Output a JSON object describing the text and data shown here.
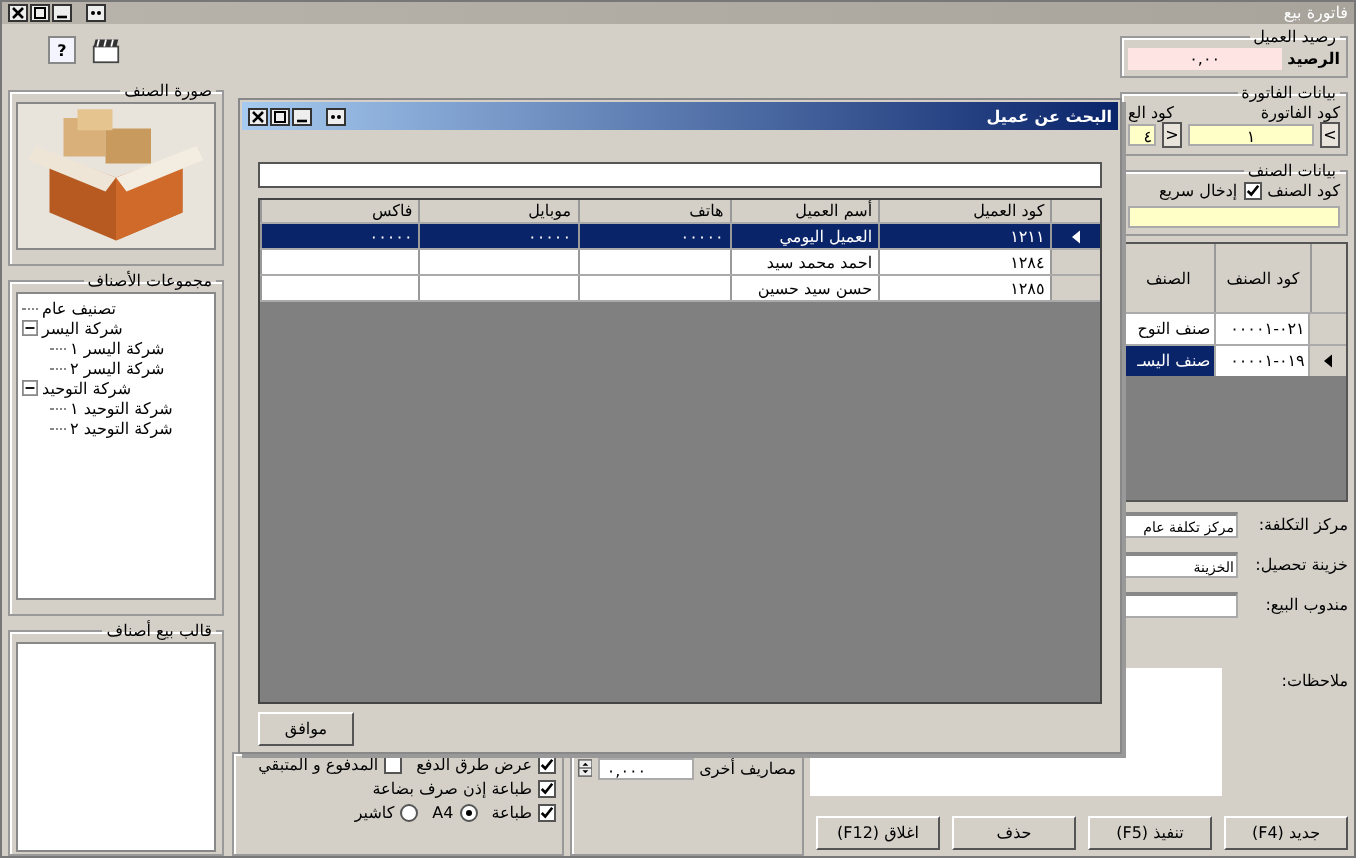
{
  "window": {
    "title": "فاتورة بيع",
    "help_glyph": "?"
  },
  "item_image": {
    "title": "صورة الصنف"
  },
  "item_groups": {
    "title": "مجموعات الأصناف",
    "tree": [
      {
        "label": "تصنيف عام"
      },
      {
        "label": "شركة اليسر",
        "expanded": true,
        "children": [
          {
            "label": "شركة اليسر ١"
          },
          {
            "label": "شركة اليسر ٢"
          }
        ]
      },
      {
        "label": "شركة التوحيد",
        "expanded": true,
        "children": [
          {
            "label": "شركة التوحيد ١"
          },
          {
            "label": "شركة التوحيد ٢"
          }
        ]
      }
    ]
  },
  "sale_template": {
    "title": "قالب بيع أصناف"
  },
  "customer_balance": {
    "title": "رصيد العميل",
    "label": "الرصيد",
    "value": "٠,٠٠"
  },
  "invoice_data": {
    "title": "بيانات الفاتورة",
    "code_label": "كود الفاتورة",
    "code_value": "١",
    "prev": "<",
    "next": ">",
    "customer_code_label": "كود الع",
    "customer_code_value": "٤"
  },
  "item_data": {
    "title": "بيانات الصنف",
    "code_label": "كود الصنف",
    "quick_entry": {
      "label": "إدخال سريع",
      "checked": true
    }
  },
  "items_grid": {
    "columns": [
      "كود الصنف",
      "الصنف"
    ],
    "rows": [
      {
        "code": "٠٢١-٠٠٠٠١",
        "name": "صنف التوح",
        "selected": false
      },
      {
        "code": "٠١٩-٠٠٠٠١",
        "name": "صنف اليسـ",
        "selected": true
      }
    ]
  },
  "fields": [
    {
      "label": "مركز التكلفة:",
      "value": "مركز تكلفة عام"
    },
    {
      "label": "خزينة تحصيل:",
      "value": "الخزينة"
    },
    {
      "label": "مندوب البيع:"
    }
  ],
  "notes": {
    "label": "ملاحظات:"
  },
  "other_expenses": {
    "label": "مصاريف أخرى",
    "value": "٠,٠٠٠"
  },
  "print_options": [
    [
      {
        "kind": "checkbox",
        "label": "عرض طرق الدفع",
        "checked": true
      },
      {
        "kind": "checkbox",
        "label": "المدفوع و المتبقي",
        "checked": false
      }
    ],
    [
      {
        "kind": "checkbox",
        "label": "طباعة إذن صرف بضاعة",
        "checked": true
      }
    ],
    [
      {
        "kind": "checkbox",
        "label": "طباعة",
        "checked": true
      },
      {
        "kind": "radio",
        "label": "A4",
        "selected": true
      },
      {
        "kind": "radio",
        "label": "كاشير",
        "selected": false
      }
    ]
  ],
  "buttons": [
    "جديد (F4)",
    "تنفيذ (F5)",
    "حذف",
    "اغلاق (F12)"
  ],
  "dialog": {
    "title": "البحث عن عميل",
    "columns": [
      "كود العميل",
      "أسم العميل",
      "هاتف",
      "موبايل",
      "فاكس"
    ],
    "rows": [
      {
        "cells": [
          "١٢١١",
          "العميل اليومي",
          "٠٠٠٠٠",
          "٠٠٠٠٠",
          "٠٠٠٠٠"
        ],
        "selected": true
      },
      {
        "cells": [
          "١٢٨٤",
          "احمد محمد سيد",
          "",
          "",
          ""
        ],
        "selected": false
      },
      {
        "cells": [
          "١٢٨٥",
          "حسن سيد حسين",
          "",
          "",
          ""
        ],
        "selected": false
      }
    ],
    "ok_button": "موافق"
  }
}
